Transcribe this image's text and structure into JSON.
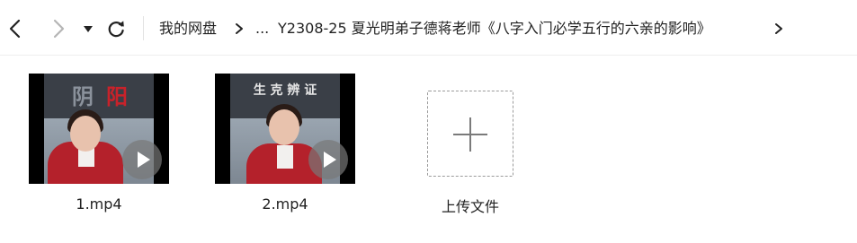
{
  "toolbar": {
    "back_icon": "chevron-left-icon",
    "forward_icon": "chevron-right-icon",
    "history_icon": "caret-down-icon",
    "refresh_icon": "refresh-icon",
    "breadcrumb": {
      "root": "我的网盘",
      "ellipsis": "...",
      "current": "Y2308-25 夏光明弟子德蒋老师《八字入门必学五行的六亲的影响》"
    },
    "separator_icon": "chevron-right-icon"
  },
  "files": [
    {
      "name": "1.mp4",
      "type": "video",
      "thumb_text_left": "阴",
      "thumb_text_right": "阳",
      "play_icon": "play-icon"
    },
    {
      "name": "2.mp4",
      "type": "video",
      "thumb_text": "生 克 辨 证",
      "play_icon": "play-icon"
    }
  ],
  "upload": {
    "label": "上传文件",
    "icon": "plus-icon"
  },
  "colors": {
    "text": "#222222",
    "forward_disabled": "#b5b5b5",
    "upload_border": "#9a9a9a",
    "red_jacket": "#b4212b"
  }
}
